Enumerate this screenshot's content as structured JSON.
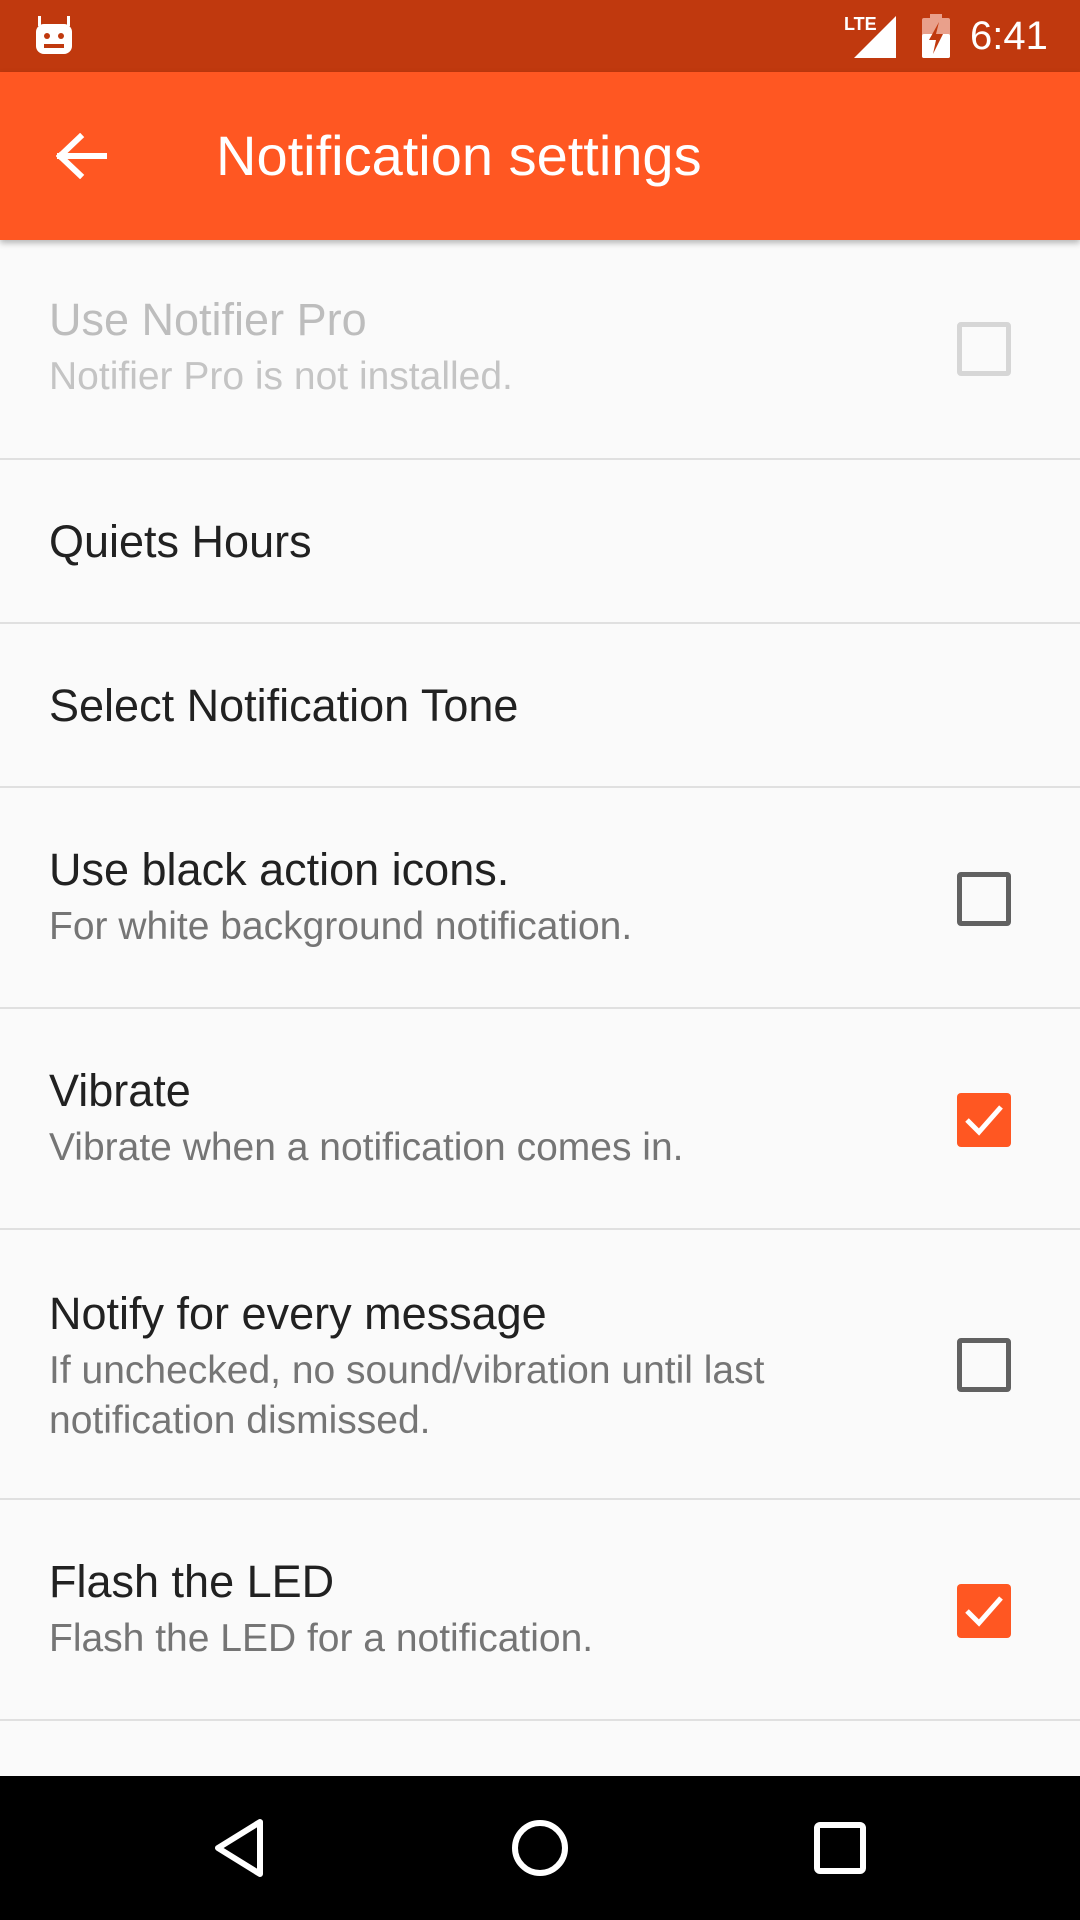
{
  "status_bar": {
    "time": "6:41",
    "network": "LTE",
    "icons": [
      "app-notification-icon",
      "lte-signal-icon",
      "battery-charging-icon"
    ]
  },
  "app_bar": {
    "title": "Notification settings",
    "back_icon": "arrow-back-icon",
    "background_color": "#ff5722",
    "status_color": "#c0390e"
  },
  "settings": [
    {
      "title": "Use Notifier Pro",
      "summary": "Notifier Pro is not installed.",
      "checkbox": true,
      "checked": false,
      "enabled": false
    },
    {
      "title": "Quiets Hours",
      "summary": "",
      "checkbox": false,
      "enabled": true
    },
    {
      "title": "Select Notification Tone",
      "summary": "",
      "checkbox": false,
      "enabled": true
    },
    {
      "title": "Use black action icons.",
      "summary": "For white background notification.",
      "checkbox": true,
      "checked": false,
      "enabled": true
    },
    {
      "title": "Vibrate",
      "summary": "Vibrate when a notification comes in.",
      "checkbox": true,
      "checked": true,
      "enabled": true
    },
    {
      "title": "Notify for every message",
      "summary_lines": [
        "If unchecked, no sound/vibration until last",
        "notification dismissed."
      ],
      "checkbox": true,
      "checked": false,
      "enabled": true
    },
    {
      "title": "Flash the LED",
      "summary": "Flash the LED for a notification.",
      "checkbox": true,
      "checked": true,
      "enabled": true
    }
  ],
  "nav_bar": {
    "icons": [
      "back-triangle-icon",
      "home-circle-icon",
      "recents-square-icon"
    ]
  },
  "accent_color": "#ff5722"
}
